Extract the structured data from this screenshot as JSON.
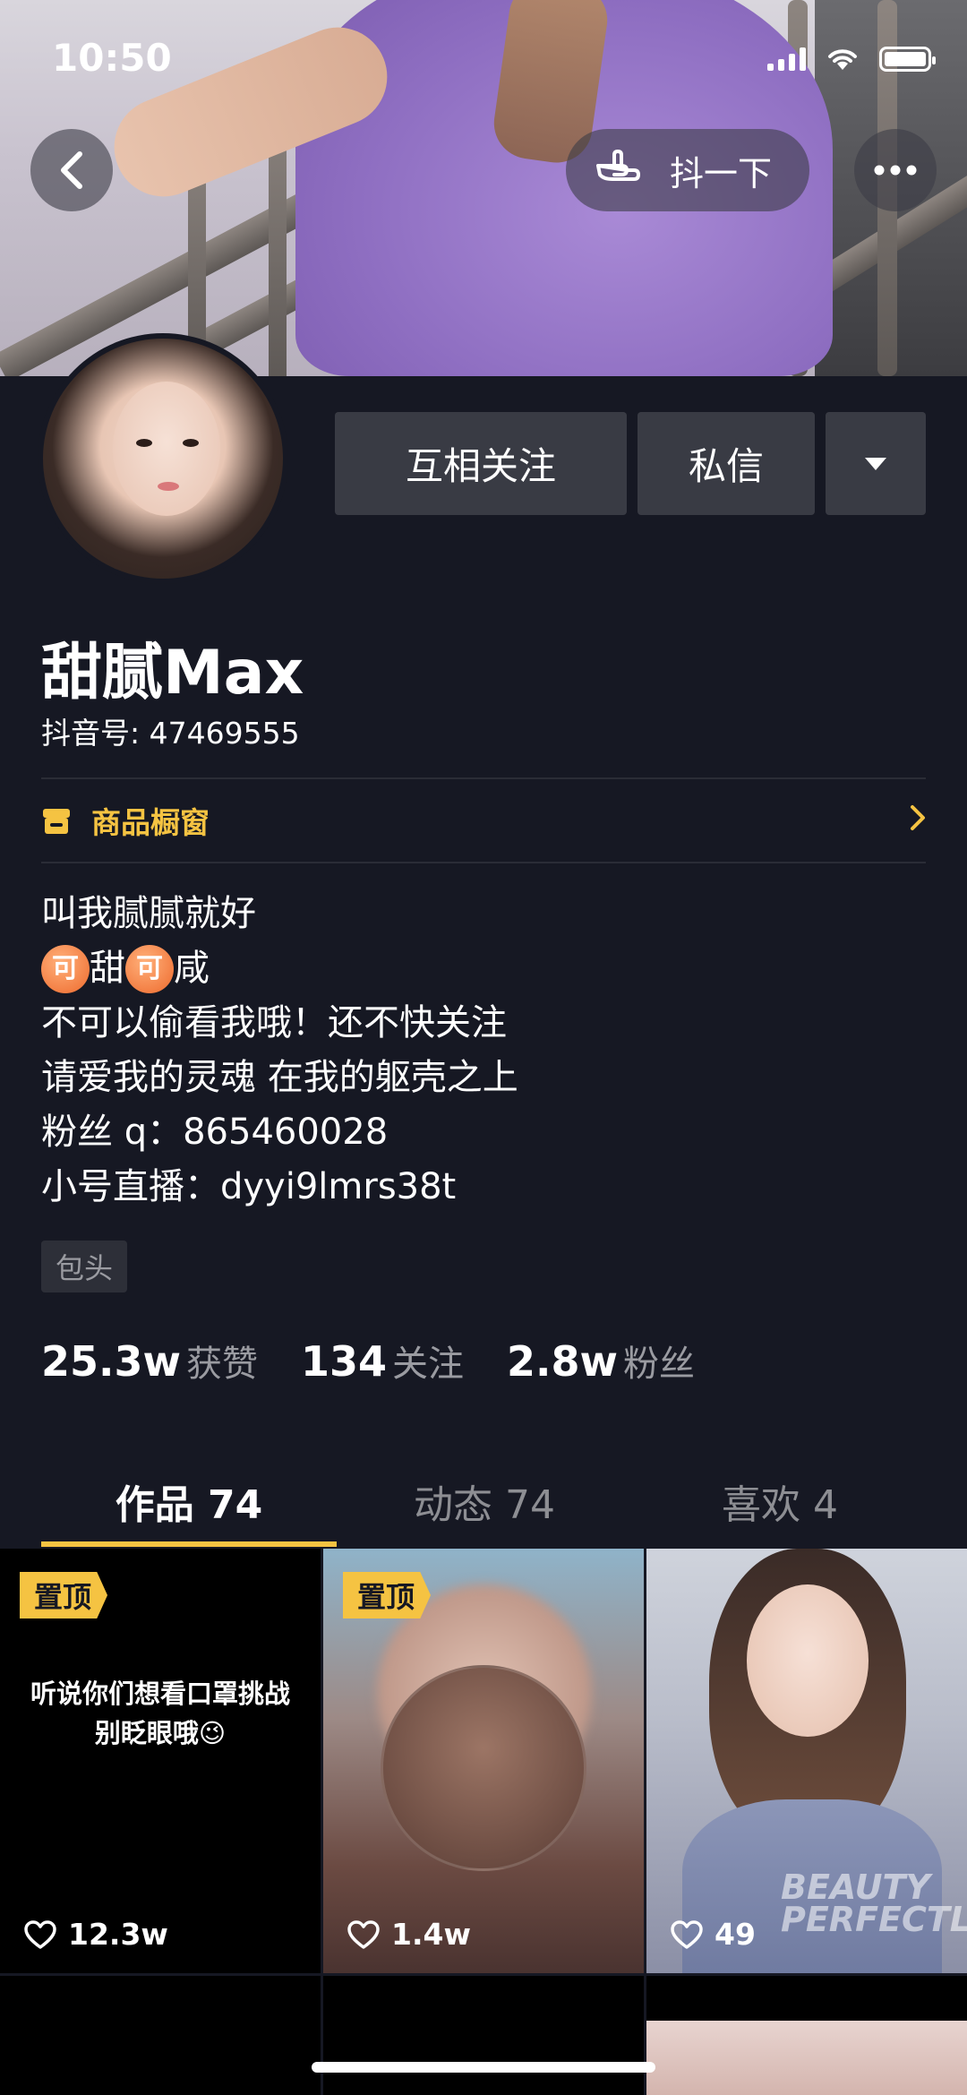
{
  "status_bar": {
    "time": "10:50"
  },
  "header": {
    "poke_label": "抖一下"
  },
  "profile": {
    "actions": {
      "mutual_follow": "互相关注",
      "message": "私信"
    },
    "nickname": "甜腻Max",
    "douyin_id": "抖音号: 47469555",
    "shop_label": "商品橱窗",
    "bio": {
      "line1": "叫我腻腻就好",
      "line2_badge": "可",
      "line2_a": "甜",
      "line2_b": "咸",
      "line3": "不可以偷看我哦！还不快关注",
      "line4": "请爱我的灵魂 在我的躯壳之上",
      "line5": "粉丝 q：865460028",
      "line6": "小号直播：dyyi9lmrs38t"
    },
    "location": "包头",
    "stats": [
      {
        "value": "25.3w",
        "label": "获赞"
      },
      {
        "value": "134",
        "label": "关注"
      },
      {
        "value": "2.8w",
        "label": "粉丝"
      }
    ]
  },
  "tabs": [
    {
      "label": "作品 74",
      "active": true
    },
    {
      "label": "动态 74",
      "active": false
    },
    {
      "label": "喜欢 4",
      "active": false
    }
  ],
  "videos": [
    {
      "pinned_label": "置顶",
      "caption_line1": "听说你们想看口罩挑战",
      "caption_line2": "别眨眼哦😉",
      "likes": "12.3w"
    },
    {
      "pinned_label": "置顶",
      "likes": "1.4w"
    },
    {
      "likes": "49",
      "overlay_text": "BEAUTY PERFECTLY"
    }
  ],
  "colors": {
    "accent": "#f5c342",
    "background": "#161823",
    "button": "#393b44"
  }
}
